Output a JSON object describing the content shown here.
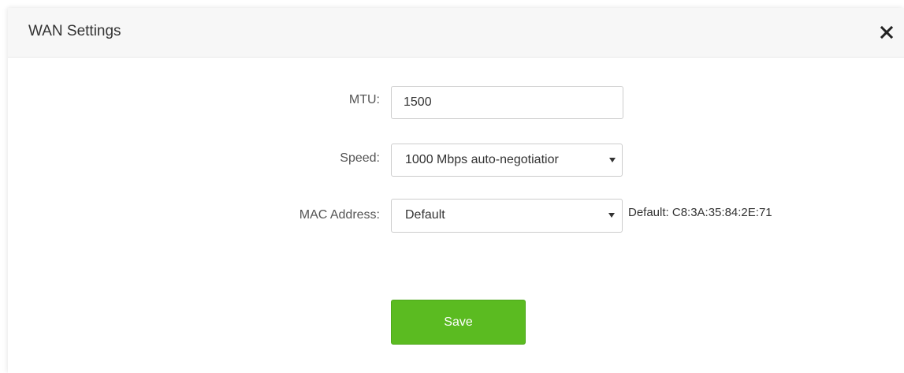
{
  "dialog": {
    "title": "WAN Settings",
    "close_icon": "close-icon"
  },
  "form": {
    "mtu": {
      "label": "MTU:",
      "value": "1500"
    },
    "speed": {
      "label": "Speed:",
      "selected": "1000 Mbps auto-negotiatior"
    },
    "mac_address": {
      "label": "MAC Address:",
      "selected": "Default",
      "hint": "Default: C8:3A:35:84:2E:71"
    }
  },
  "actions": {
    "save_label": "Save"
  },
  "colors": {
    "accent": "#5bbb21",
    "header_bg": "#f7f7f7"
  }
}
